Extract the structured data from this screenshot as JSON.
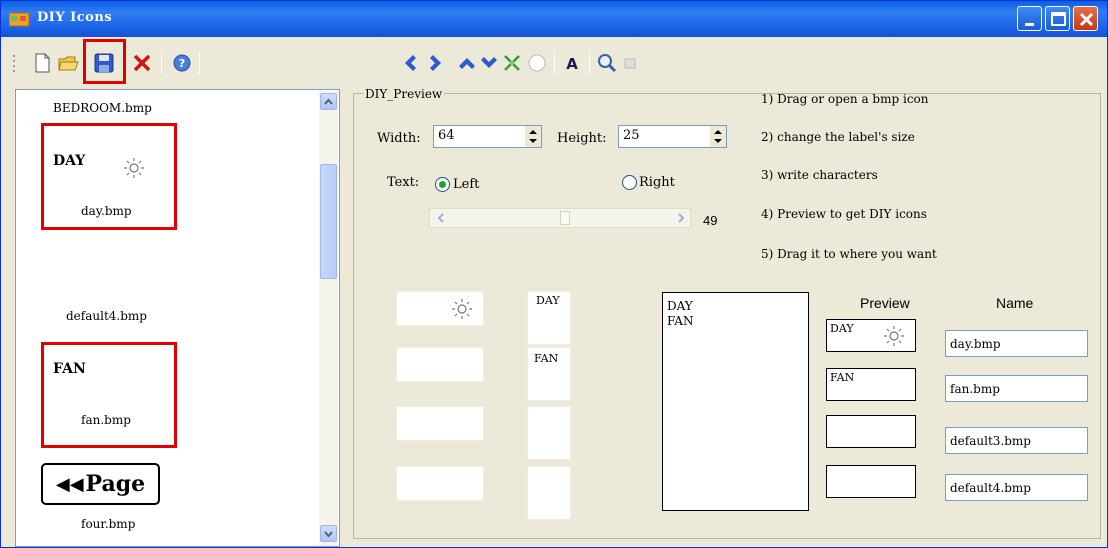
{
  "window": {
    "title": "DIY Icons"
  },
  "file_list": {
    "items": [
      {
        "label": "BEDROOM.bmp"
      },
      {
        "label": "day.bmp",
        "icon_text": "DAY"
      },
      {
        "label": "default4.bmp"
      },
      {
        "label": "fan.bmp",
        "icon_text": "FAN"
      },
      {
        "label": "four.bmp",
        "icon_text": "Page"
      }
    ]
  },
  "preview_group": {
    "legend": "DIY_Preview",
    "width_label": "Width:",
    "width_value": "64",
    "height_label": "Height:",
    "height_value": "25",
    "text_label": "Text:",
    "radio_left": "Left",
    "radio_right": "Right",
    "selected_alignment": "Left",
    "slider_value": "49",
    "slider_fraction": 0.5
  },
  "instructions": [
    "1) Drag or open a bmp icon",
    "2) change the label's size",
    "3) write characters",
    "4) Preview to get DIY icons",
    "5) Drag it to where you want"
  ],
  "text_cells": [
    "DAY",
    "FAN",
    "",
    ""
  ],
  "listbox": {
    "lines": [
      "DAY",
      "FAN"
    ]
  },
  "table": {
    "preview_header": "Preview",
    "name_header": "Name",
    "rows": [
      {
        "preview_text": "DAY",
        "has_sun": true,
        "name": "day.bmp"
      },
      {
        "preview_text": "FAN",
        "has_sun": false,
        "name": "fan.bmp"
      },
      {
        "preview_text": "",
        "has_sun": false,
        "name": "default3.bmp"
      },
      {
        "preview_text": "",
        "has_sun": false,
        "name": "default4.bmp"
      }
    ]
  },
  "colors": {
    "titlebar": "#0a5fe4",
    "highlight_red": "#e00000",
    "radio_selected": "#21a121"
  }
}
